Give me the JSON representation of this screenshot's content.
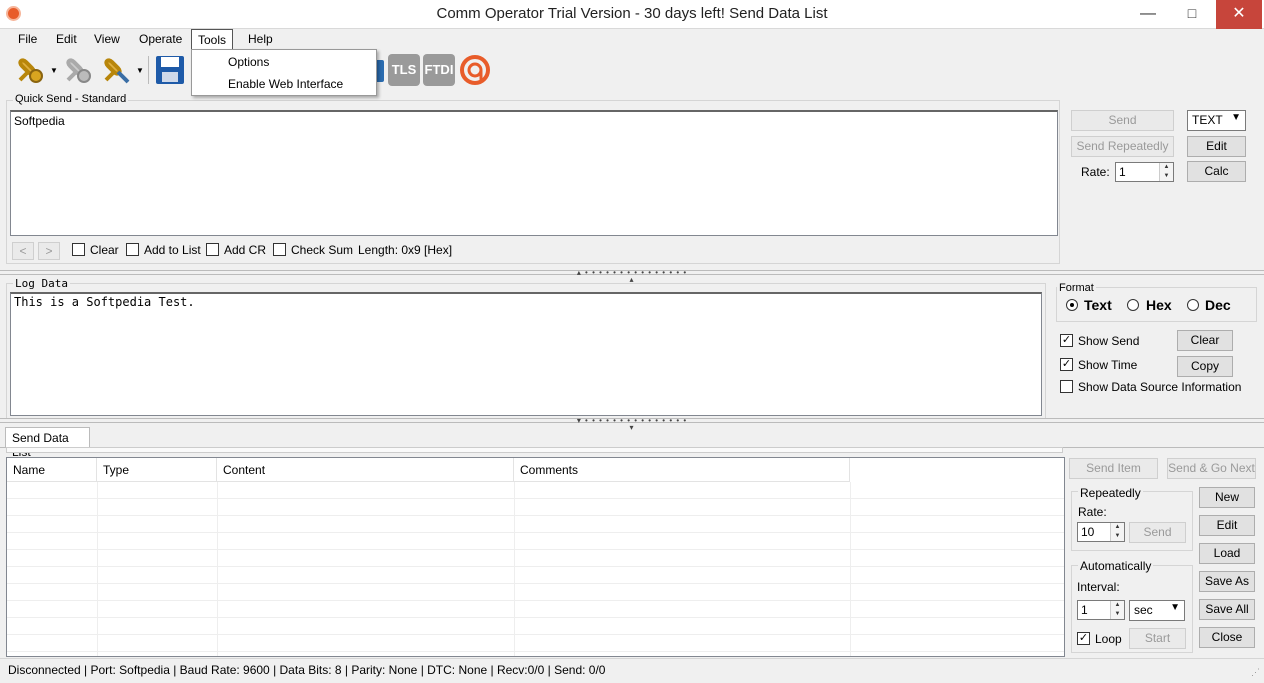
{
  "window": {
    "title": "Comm Operator Trial Version - 30 days left!   Send Data List",
    "minimize": "—",
    "maximize": "□",
    "close": "✕"
  },
  "menu": [
    "File",
    "Edit",
    "View",
    "Operate",
    "Tools",
    "Help"
  ],
  "tools_menu": {
    "options": "Options",
    "enable_web": "Enable Web Interface"
  },
  "toolbar_icons": [
    "connect-icon",
    "disconnect-icon",
    "port-config-icon",
    "save-icon",
    "ssl-icon",
    "tls-icon",
    "ftdi-icon",
    "about-icon"
  ],
  "toolbar_text": {
    "tls": "TLS",
    "ftdi": "FTDI"
  },
  "quick_send": {
    "label": "Quick Send - Standard",
    "content": "Softpedia",
    "prev": "<",
    "next": ">",
    "clear": "Clear",
    "add_to_list": "Add to List",
    "add_cr": "Add CR",
    "check_sum": "Check Sum",
    "length": "Length: 0x9 [Hex]",
    "send": "Send",
    "send_repeatedly": "Send Repeatedly",
    "rate_label": "Rate:",
    "rate": "1",
    "mode": "TEXT",
    "edit": "Edit",
    "calc": "Calc"
  },
  "log": {
    "label": "Log Data",
    "content": "This is a Softpedia Test.",
    "format_label": "Format",
    "format_options": [
      "Text",
      "Hex",
      "Dec"
    ],
    "selected_format": "Text",
    "show_send": "Show Send",
    "show_time": "Show Time",
    "show_source": "Show Data Source Information",
    "clear": "Clear",
    "copy": "Copy"
  },
  "send_list": {
    "tab": "Send Data List",
    "columns": [
      "Name",
      "Type",
      "Content",
      "Comments"
    ],
    "send_item": "Send Item",
    "send_go_next": "Send & Go Next",
    "repeatedly_label": "Repeatedly",
    "rate_label": "Rate:",
    "rate": "10",
    "send": "Send",
    "automatically_label": "Automatically",
    "interval_label": "Interval:",
    "interval": "1",
    "interval_unit": "sec",
    "loop": "Loop",
    "start": "Start",
    "new": "New",
    "edit": "Edit",
    "load": "Load",
    "save_as": "Save As",
    "save_all": "Save All",
    "close": "Close"
  },
  "status": "Disconnected | Port: Softpedia | Baud Rate: 9600 | Data Bits: 8 | Parity: None | DTC: None | Recv:0/0 | Send: 0/0",
  "colors": {
    "accent": "#e85c2a",
    "close_button": "#c7453b"
  }
}
